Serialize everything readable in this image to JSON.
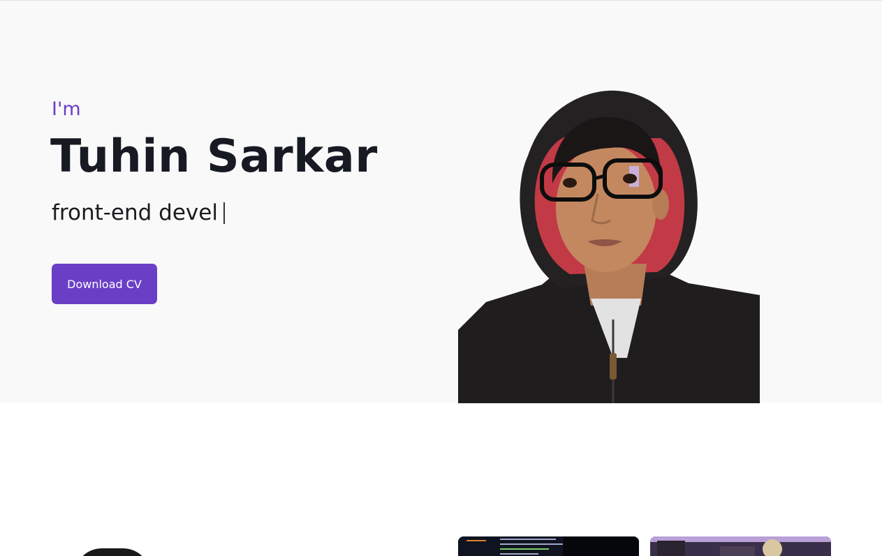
{
  "hero": {
    "greeting": "I'm",
    "name": "Tuhin Sarkar",
    "role_typed": "front-end devel",
    "cta_label": "Download CV"
  },
  "colors": {
    "accent": "#6a3fc6",
    "hero_bg": "#f9f9f9",
    "heading": "#171a22"
  }
}
